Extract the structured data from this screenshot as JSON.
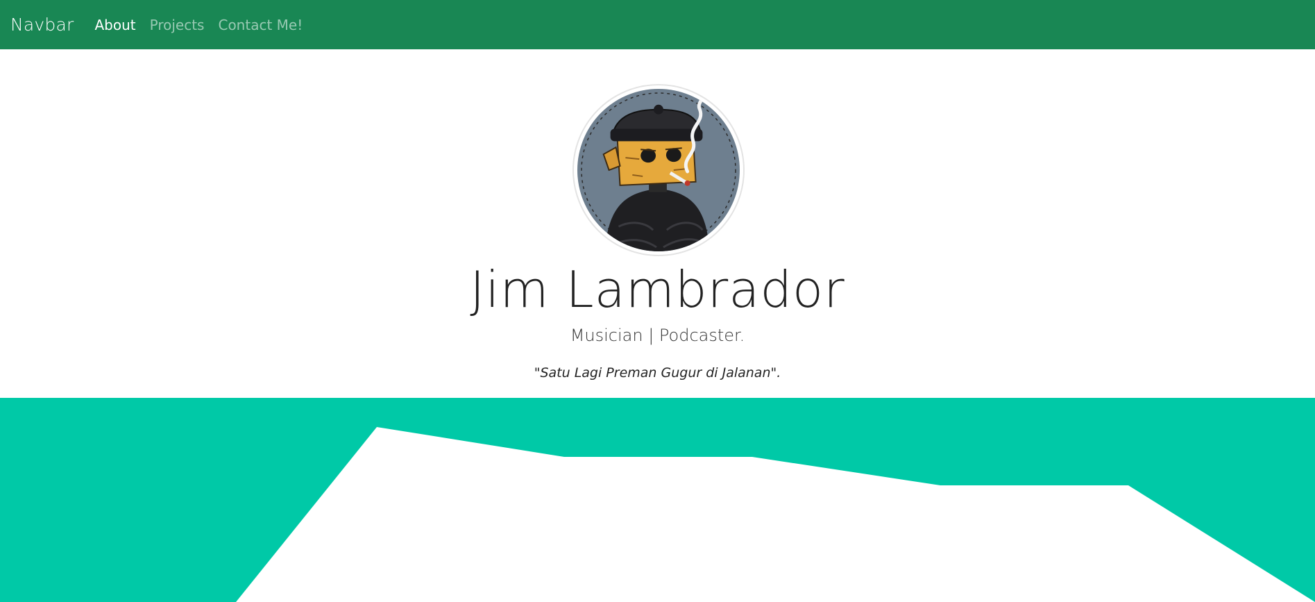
{
  "navbar": {
    "brand": "Navbar",
    "links": [
      {
        "label": "About",
        "active": true
      },
      {
        "label": "Projects",
        "active": false
      },
      {
        "label": "Contact Me!",
        "active": false
      }
    ]
  },
  "hero": {
    "name": "Jim Lambrador",
    "tagline": "Musician | Podcaster.",
    "quote": "\"Satu Lagi Preman Gugur di Jalanan\"."
  },
  "colors": {
    "navbar_bg": "#198754",
    "accent_teal": "#00c9a7"
  },
  "icons": {
    "avatar": "cartoon-avatar-box-head-beanie-smoking"
  }
}
